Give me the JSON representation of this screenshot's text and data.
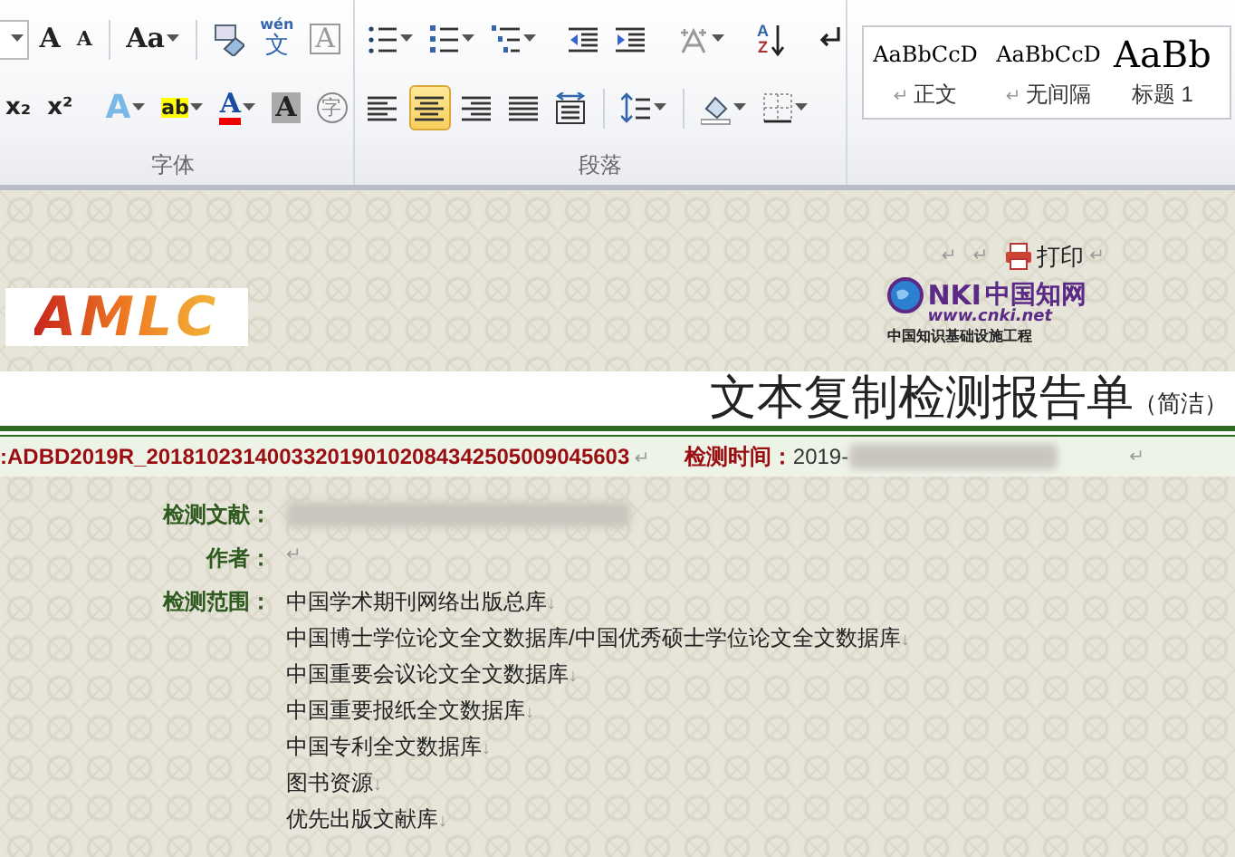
{
  "ribbon": {
    "groups": [
      {
        "label": "字体",
        "top_row": [
          {
            "kind": "fontsize",
            "dropdown": true
          },
          {
            "kind": "grow",
            "glyph": "A"
          },
          {
            "kind": "shrink",
            "glyph": "A"
          },
          {
            "kind": "sep"
          },
          {
            "kind": "case",
            "glyph": "Aa",
            "dropdown": true
          },
          {
            "kind": "sep"
          },
          {
            "kind": "clear"
          },
          {
            "kind": "phonetic",
            "glyph": "wén",
            "glyph2": "文"
          },
          {
            "kind": "border",
            "glyph": "A"
          }
        ],
        "bottom_row": [
          {
            "kind": "sub",
            "glyph": "x₂"
          },
          {
            "kind": "sup",
            "glyph": "x²"
          },
          {
            "kind": "sep"
          },
          {
            "kind": "effect",
            "glyph": "A",
            "dropdown": true
          },
          {
            "kind": "highlight",
            "glyph": "ab",
            "dropdown": true
          },
          {
            "kind": "fontcolor",
            "glyph": "A",
            "dropdown": true
          },
          {
            "kind": "shade",
            "glyph": "A"
          },
          {
            "kind": "enclose",
            "glyph": "字"
          }
        ]
      },
      {
        "label": "段落",
        "top_row": [
          {
            "kind": "bullets",
            "dropdown": true
          },
          {
            "kind": "numbering",
            "dropdown": true
          },
          {
            "kind": "multilevel",
            "dropdown": true
          },
          {
            "kind": "sep"
          },
          {
            "kind": "outdent"
          },
          {
            "kind": "indent"
          },
          {
            "kind": "sep"
          },
          {
            "kind": "asian",
            "dropdown": true
          },
          {
            "kind": "sep"
          },
          {
            "kind": "sort",
            "glyph": "A",
            "glyph2": "Z"
          },
          {
            "kind": "sep"
          },
          {
            "kind": "marks"
          }
        ],
        "bottom_row": [
          {
            "kind": "left",
            "selected": false
          },
          {
            "kind": "center",
            "selected": true
          },
          {
            "kind": "right",
            "selected": false
          },
          {
            "kind": "justify",
            "selected": false
          },
          {
            "kind": "distribute",
            "selected": false
          },
          {
            "kind": "sep"
          },
          {
            "kind": "spacing",
            "dropdown": true
          },
          {
            "kind": "sep"
          },
          {
            "kind": "fill",
            "dropdown": true
          },
          {
            "kind": "borders",
            "dropdown": true
          }
        ]
      }
    ],
    "styles": [
      {
        "preview": "AaBbCcD",
        "label": "正文",
        "mark": "↵",
        "kind": "normal"
      },
      {
        "preview": "AaBbCcD",
        "label": "无间隔",
        "mark": "↵",
        "kind": "normal"
      },
      {
        "preview": "AaBb",
        "label": "标题 1",
        "kind": "heading"
      }
    ]
  },
  "document": {
    "lead_marks": [
      "↵",
      "↵"
    ],
    "print": {
      "label": "打印",
      "mark": "↵"
    },
    "logo": {
      "text": "AMLC"
    },
    "cnki": {
      "brand": "NKI",
      "cn": "中国知网",
      "url": "www.cnki.net",
      "tagline": "中国知识基础设施工程"
    },
    "title": "文本复制检测报告单",
    "subtitle": "（简洁）",
    "report_no": {
      "text": ":ADBD2019R_2018102314003320190102084342505009045603",
      "mark": "↵"
    },
    "check_time": {
      "label": "检测时间：",
      "value": "2019-",
      "mark": "↵"
    },
    "fields": [
      {
        "label": "检测文献：",
        "kind": "redacted"
      },
      {
        "label": "作者：",
        "kind": "empty",
        "mark": "↵"
      },
      {
        "label": "检测范围：",
        "kind": "list",
        "items": [
          {
            "text": "中国学术期刊网络出版总库",
            "mark": "↓"
          },
          {
            "text": "中国博士学位论文全文数据库/中国优秀硕士学位论文全文数据库",
            "mark": "↓"
          },
          {
            "text": "中国重要会议论文全文数据库",
            "mark": "↓"
          },
          {
            "text": "中国重要报纸全文数据库",
            "mark": "↓"
          },
          {
            "text": "中国专利全文数据库",
            "mark": "↓"
          },
          {
            "text": "图书资源",
            "mark": "↓"
          },
          {
            "text": "优先出版文献库",
            "mark": "↓"
          }
        ]
      }
    ]
  }
}
